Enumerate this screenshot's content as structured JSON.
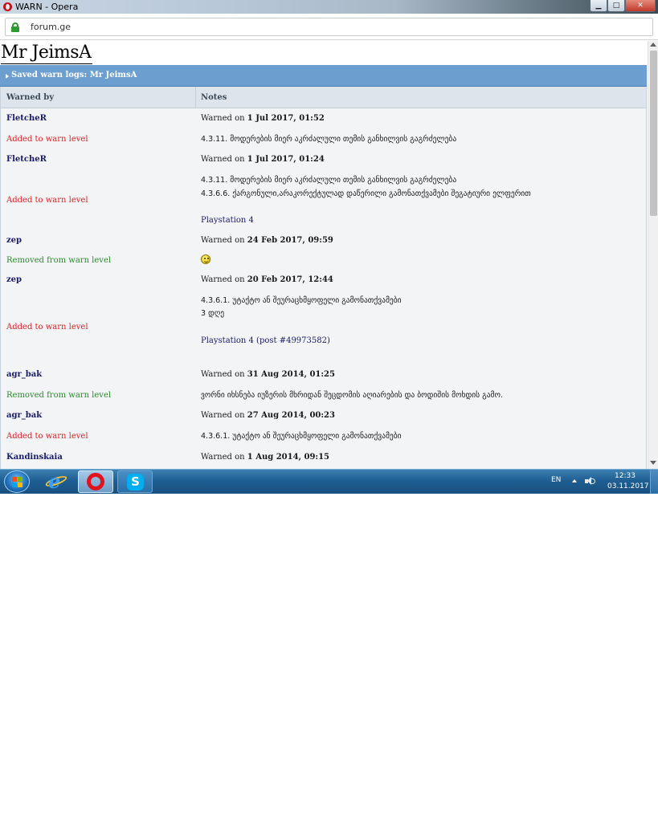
{
  "window": {
    "title": "WARN - Opera",
    "minimize_label": "▁",
    "maximize_label": "□",
    "close_label": "✕"
  },
  "address_bar": {
    "url": "forum.ge"
  },
  "page": {
    "title": "Mr JeimsA",
    "section_title": "Saved warn logs: Mr JeimsA",
    "columns": {
      "warned_by": "Warned by",
      "notes": "Notes"
    },
    "entries": [
      {
        "user": "FletcheR",
        "warned_prefix": "Warned on",
        "date": "1 Jul 2017, 01:52",
        "action": "Added to warn level",
        "notes": [
          "4.3.11. მოდერების მიერ აკრძალული თემის განხილვის გაგრძელება"
        ],
        "link": ""
      },
      {
        "user": "FletcheR",
        "warned_prefix": "Warned on",
        "date": "1 Jul 2017, 01:24",
        "action": "Added to warn level",
        "notes": [
          "4.3.11. მოდერების მიერ აკრძალული თემის განხილვის გაგრძელება",
          "4.3.6.6. ქარგონული,არაკორექტულად დაწერილი გამონათქვამები შეგატიური ელფერით"
        ],
        "link": "Playstation 4"
      },
      {
        "user": "zep",
        "warned_prefix": "Warned on",
        "date": "24 Feb 2017, 09:59",
        "action": "Removed from warn level",
        "notes": [],
        "note_icon": "smiley-icon",
        "link": ""
      },
      {
        "user": "zep",
        "warned_prefix": "Warned on",
        "date": "20 Feb 2017, 12:44",
        "action": "Added to warn level",
        "notes": [
          "4.3.6.1. უტაქტო ან შეურაცხმყოფელი გამონათქვამები",
          "3 დღე"
        ],
        "link": "Playstation 4 (post #49973582)"
      },
      {
        "user": "agr_bak",
        "warned_prefix": "Warned on",
        "date": "31 Aug 2014, 01:25",
        "action": "Removed from warn level",
        "notes": [
          "ვორნი იხსნება იუზერის მხრიდან შეცდომის აღიარების და ბოდიშის მოხდის გამო."
        ],
        "link": ""
      },
      {
        "user": "agr_bak",
        "warned_prefix": "Warned on",
        "date": "27 Aug 2014, 00:23",
        "action": "Added to warn level",
        "notes": [
          "4.3.6.1. უტაქტო ან შეურაცხმყოფელი გამონათქვამები"
        ],
        "link": ""
      },
      {
        "user": "Kandinskaia",
        "warned_prefix": "Warned on",
        "date": "1 Aug 2014, 09:15",
        "action": "",
        "notes": [],
        "link": ""
      }
    ]
  },
  "taskbar": {
    "ie_glyph": "e",
    "skype_glyph": "S",
    "language": "EN",
    "time": "12:33",
    "date": "03.11.2017"
  },
  "colors": {
    "section_bar": "#6c9fd0",
    "username": "#1a1a6e",
    "added": "#e02020",
    "removed": "#2a8a2a",
    "taskbar": "#1f5f93"
  }
}
